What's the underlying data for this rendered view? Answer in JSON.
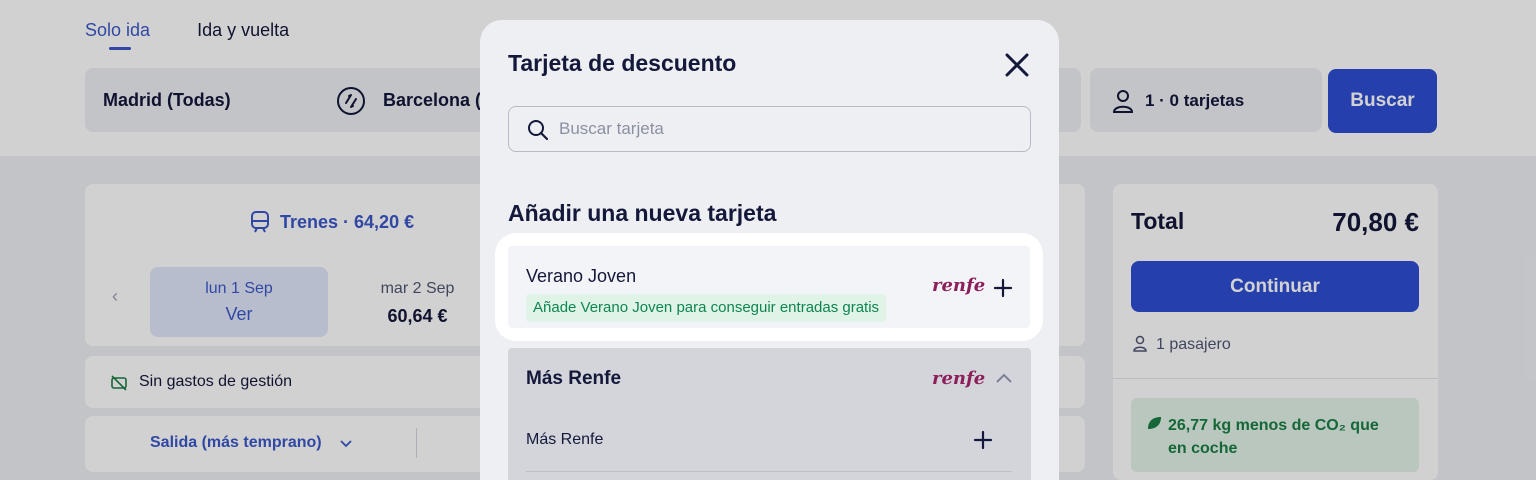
{
  "tabs": [
    {
      "label": "Solo ida",
      "active": true
    },
    {
      "label": "Ida y vuelta",
      "active": false
    }
  ],
  "search": {
    "origin": "Madrid (Todas)",
    "destination": "Barcelona (",
    "passengers": "1 · 0 tarjetas",
    "button": "Buscar"
  },
  "results": {
    "trains_label": "Trenes · 64,20 €",
    "dates": [
      {
        "day": "lun 1 Sep",
        "price": "Ver",
        "selected": true
      },
      {
        "day": "mar 2 Sep",
        "price": "60,64 €",
        "selected": false
      }
    ],
    "fees": "Sin gastos de gestión",
    "sort": "Salida (más temprano)"
  },
  "summary": {
    "total_label": "Total",
    "total_value": "70,80 €",
    "continue": "Continuar",
    "passengers": "1 pasajero",
    "co2": "26,77 kg menos de CO₂ que en coche"
  },
  "modal": {
    "title": "Tarjeta de descuento",
    "search_placeholder": "Buscar tarjeta",
    "search_value": "",
    "section_title": "Añadir una nueva tarjeta",
    "highlight_card": {
      "name": "Verano Joven",
      "promo": "Añade Verano Joven para conseguir entradas gratis",
      "brand": "renfe"
    },
    "group": {
      "title": "Más Renfe",
      "brand": "renfe",
      "items": [
        {
          "name": "Más Renfe"
        }
      ]
    }
  },
  "colors": {
    "primary": "#2e4fd3",
    "link_blue": "#3b58c9",
    "renfe": "#8c1f5a",
    "promo_green": "#0f8550"
  },
  "icons": [
    "swap-icon",
    "user-icon",
    "train-icon",
    "chevron-left-icon",
    "no-fee-icon",
    "chevron-down-icon",
    "leaf-icon",
    "close-icon",
    "search-icon",
    "plus-icon",
    "chevron-up-icon"
  ]
}
